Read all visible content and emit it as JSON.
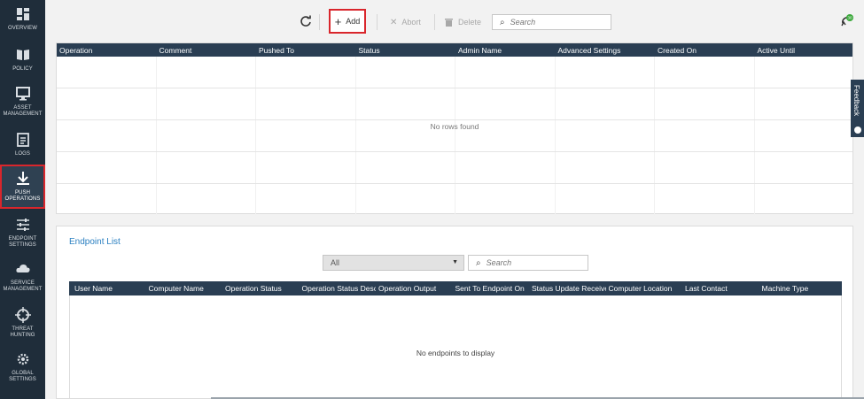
{
  "sidebar": {
    "items": [
      {
        "label": "OVERVIEW",
        "icon": "grid-icon"
      },
      {
        "label": "POLICY",
        "icon": "book-icon"
      },
      {
        "label": "ASSET MANAGEMENT",
        "icon": "monitor-icon"
      },
      {
        "label": "LOGS",
        "icon": "clipboard-icon"
      },
      {
        "label": "PUSH OPERATIONS",
        "icon": "download-icon",
        "active": true
      },
      {
        "label": "ENDPOINT SETTINGS",
        "icon": "sliders-icon"
      },
      {
        "label": "SERVICE MANAGEMENT",
        "icon": "cloud-icon"
      },
      {
        "label": "THREAT HUNTING",
        "icon": "crosshair-icon"
      },
      {
        "label": "GLOBAL SETTINGS",
        "icon": "gear-icon"
      }
    ]
  },
  "toolbar": {
    "add_label": "Add",
    "abort_label": "Abort",
    "delete_label": "Delete",
    "search_placeholder": "Search"
  },
  "status": {
    "badge": "30"
  },
  "operations": {
    "columns": [
      "Operation",
      "Comment",
      "Pushed To",
      "Status",
      "Admin Name",
      "Advanced Settings",
      "Created On",
      "Active Until"
    ],
    "empty_text": "No rows found"
  },
  "endpoints": {
    "title": "Endpoint List",
    "filter_value": "All",
    "search_placeholder": "Search",
    "columns": [
      "User Name",
      "Computer Name",
      "Operation Status",
      "Operation Status Desc",
      "Operation Output",
      "Sent To Endpoint On",
      "Status Update Receive",
      "Computer Location",
      "Last Contact",
      "Machine Type"
    ],
    "empty_text": "No endpoints to display"
  },
  "feedback": {
    "label": "Feedback"
  },
  "colors": {
    "sidebar": "#1f2d3a",
    "header": "#2a3e53",
    "highlight": "#d9262c",
    "link": "#2a7fc1"
  }
}
